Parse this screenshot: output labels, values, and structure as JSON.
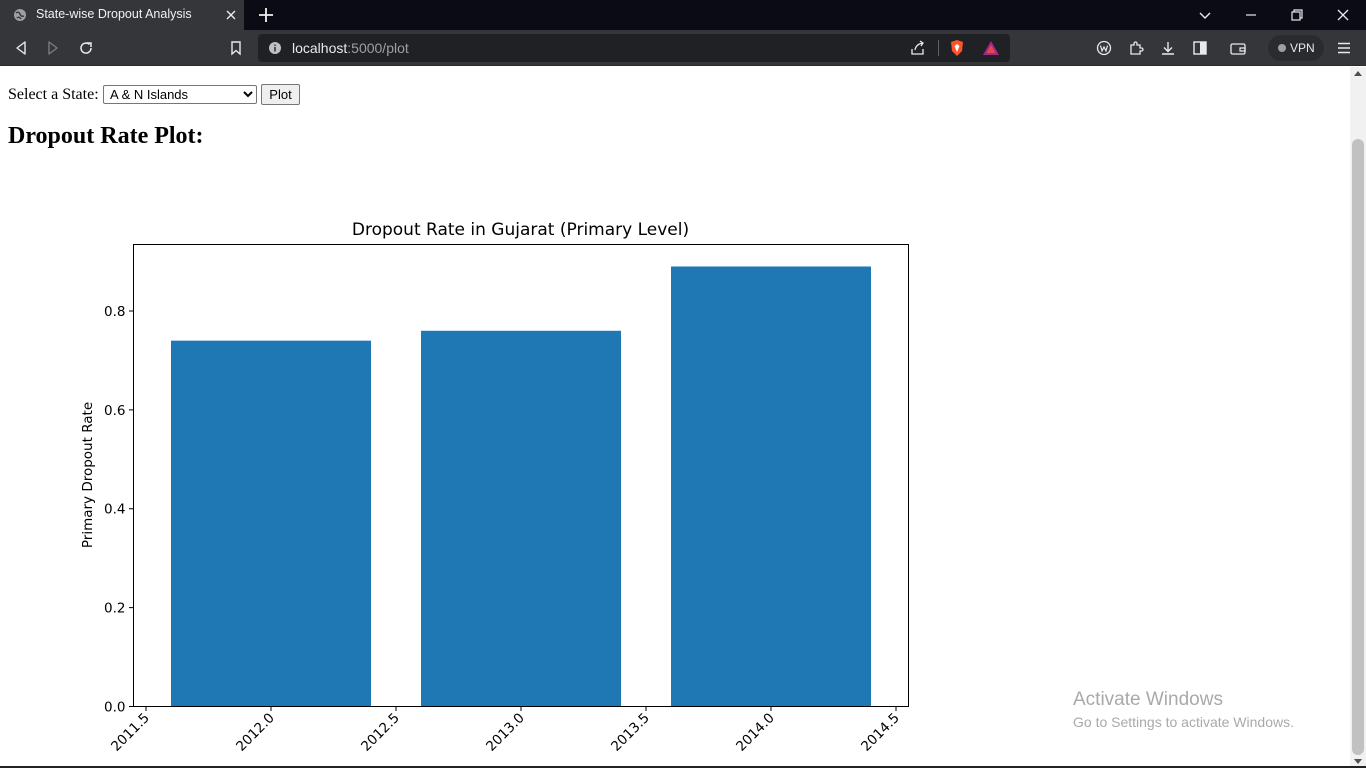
{
  "browser": {
    "tab_title": "State-wise Dropout Analysis",
    "url_host": "localhost",
    "url_rest": ":5000/plot",
    "vpn_label": "VPN"
  },
  "form": {
    "label": "Select a State:",
    "selected_state": "A & N Islands",
    "button_label": "Plot"
  },
  "heading": "Dropout Rate Plot:",
  "chart_data": {
    "type": "bar",
    "title": "Dropout Rate in Gujarat (Primary Level)",
    "xlabel": "",
    "ylabel": "Primary Dropout Rate",
    "x": [
      2012.0,
      2013.0,
      2014.0
    ],
    "values": [
      0.74,
      0.76,
      0.89
    ],
    "bar_width": 0.8,
    "xlim": [
      2011.45,
      2014.55
    ],
    "ylim": [
      0.0,
      0.9345
    ],
    "xticks": [
      "2011.5",
      "2012.0",
      "2012.5",
      "2013.0",
      "2013.5",
      "2014.0",
      "2014.5"
    ],
    "yticks": [
      "0.0",
      "0.2",
      "0.4",
      "0.6",
      "0.8"
    ],
    "bar_color": "#1f77b4",
    "grid": false,
    "legend": "none"
  },
  "watermark": {
    "line1": "Activate Windows",
    "line2": "Go to Settings to activate Windows."
  }
}
